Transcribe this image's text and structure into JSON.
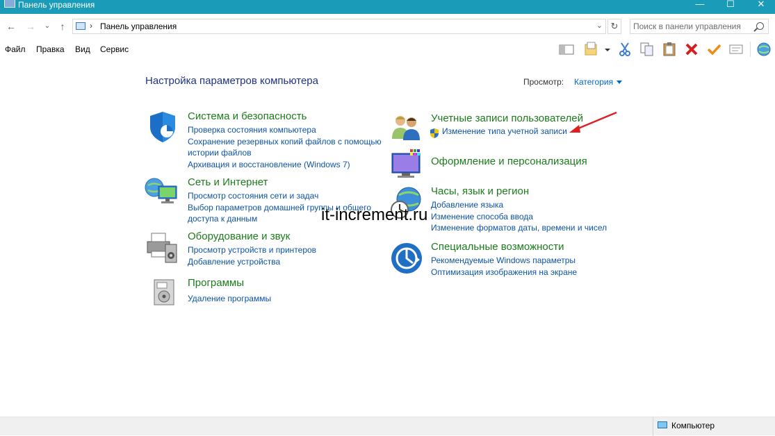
{
  "window": {
    "title": "Панель управления",
    "minimize": "—",
    "maximize": "☐",
    "close": "✕"
  },
  "nav": {
    "back": "←",
    "forward": "→",
    "recent": "⌄",
    "up": "↑"
  },
  "address": {
    "separator": "›",
    "crumb": "Панель управления",
    "dropdown": "⌄",
    "refresh": "↻"
  },
  "search": {
    "placeholder": "Поиск в панели управления"
  },
  "menu": [
    "Файл",
    "Правка",
    "Вид",
    "Сервис"
  ],
  "toolbar_icons": [
    "preview-pane-icon",
    "folder-options-icon",
    "cut-icon",
    "copy-icon",
    "paste-icon",
    "delete-icon",
    "check-icon",
    "properties-icon",
    "globe-icon"
  ],
  "main": {
    "heading": "Настройка параметров компьютера",
    "view_label": "Просмотр:",
    "view_value": "Категория"
  },
  "categories_left": [
    {
      "title": "Система и безопасность",
      "icon": "shield-icon",
      "links": [
        "Проверка состояния компьютера",
        "Сохранение резервных копий файлов с помощью",
        "истории файлов",
        "Архивация и восстановление (Windows 7)"
      ]
    },
    {
      "title": "Сеть и Интернет",
      "icon": "network-icon",
      "links": [
        "Просмотр состояния сети и задач",
        "Выбор параметров домашней группы и общего",
        "доступа к данным"
      ]
    },
    {
      "title": "Оборудование и звук",
      "icon": "printer-icon",
      "links": [
        "Просмотр устройств и принтеров",
        "Добавление устройства"
      ]
    },
    {
      "title": "Программы",
      "icon": "programs-icon",
      "links": [
        "Удаление программы"
      ]
    }
  ],
  "categories_right": [
    {
      "title": "Учетные записи пользователей",
      "icon": "users-icon",
      "links": [
        "Изменение типа учетной записи"
      ]
    },
    {
      "title": "Оформление и персонализация",
      "icon": "monitor-icon",
      "links": []
    },
    {
      "title": "Часы, язык и регион",
      "icon": "clock-globe-icon",
      "links": [
        "Добавление языка",
        "Изменение способа ввода",
        "Изменение форматов даты, времени и чисел"
      ]
    },
    {
      "title": "Специальные возможности",
      "icon": "accessibility-icon",
      "links": [
        "Рекомендуемые Windows параметры",
        "Оптимизация изображения на экране"
      ]
    }
  ],
  "watermark": "it-increment.ru",
  "status": {
    "text": "Компьютер"
  },
  "colors": {
    "titlebar": "#1a9bb8",
    "category_title": "#1b7c1b",
    "link": "#0d54a7",
    "heading": "#1e3287",
    "annotation_arrow": "#e02020"
  }
}
